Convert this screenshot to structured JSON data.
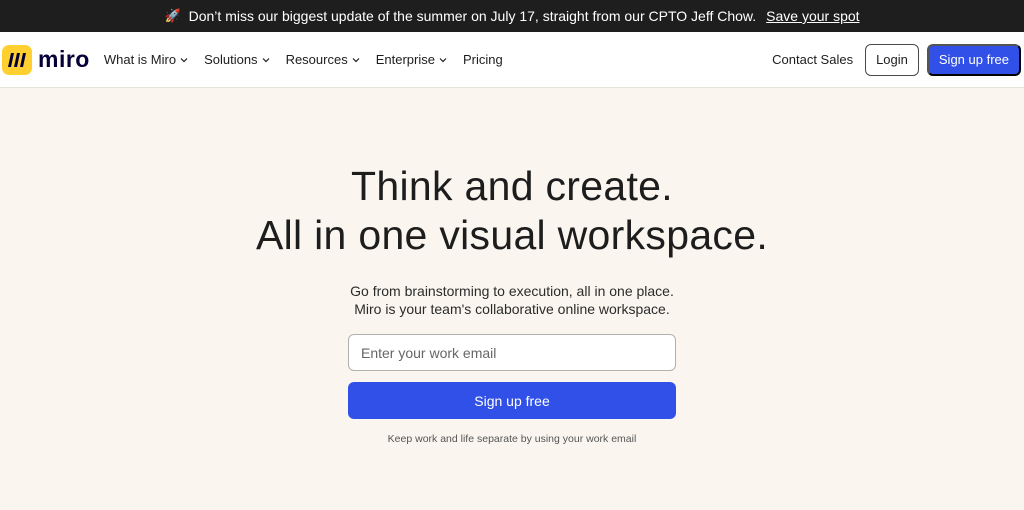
{
  "banner": {
    "icon": "rocket-icon",
    "text": "Don’t miss our biggest update of the summer on July 17, straight from our CPTO Jeff Chow.",
    "link": "Save your spot"
  },
  "nav": {
    "logo_text": "miro",
    "items": [
      {
        "label": "What is Miro",
        "has_dropdown": true
      },
      {
        "label": "Solutions",
        "has_dropdown": true
      },
      {
        "label": "Resources",
        "has_dropdown": true
      },
      {
        "label": "Enterprise",
        "has_dropdown": true
      },
      {
        "label": "Pricing",
        "has_dropdown": false
      }
    ],
    "contact": "Contact Sales",
    "login": "Login",
    "signup": "Sign up free"
  },
  "hero": {
    "title_line1": "Think and create.",
    "title_line2": "All in one visual workspace.",
    "sub_line1": "Go from brainstorming to execution, all in one place.",
    "sub_line2": "Miro is your team's collaborative online workspace.",
    "email_placeholder": "Enter your work email",
    "email_value": "",
    "cta": "Sign up free",
    "note": "Keep work and life separate by using your work email"
  },
  "colors": {
    "accent": "#3050e8",
    "logo_yellow": "#ffd02f",
    "banner_bg": "#1f1e1e",
    "page_bg": "#faf6ef"
  }
}
